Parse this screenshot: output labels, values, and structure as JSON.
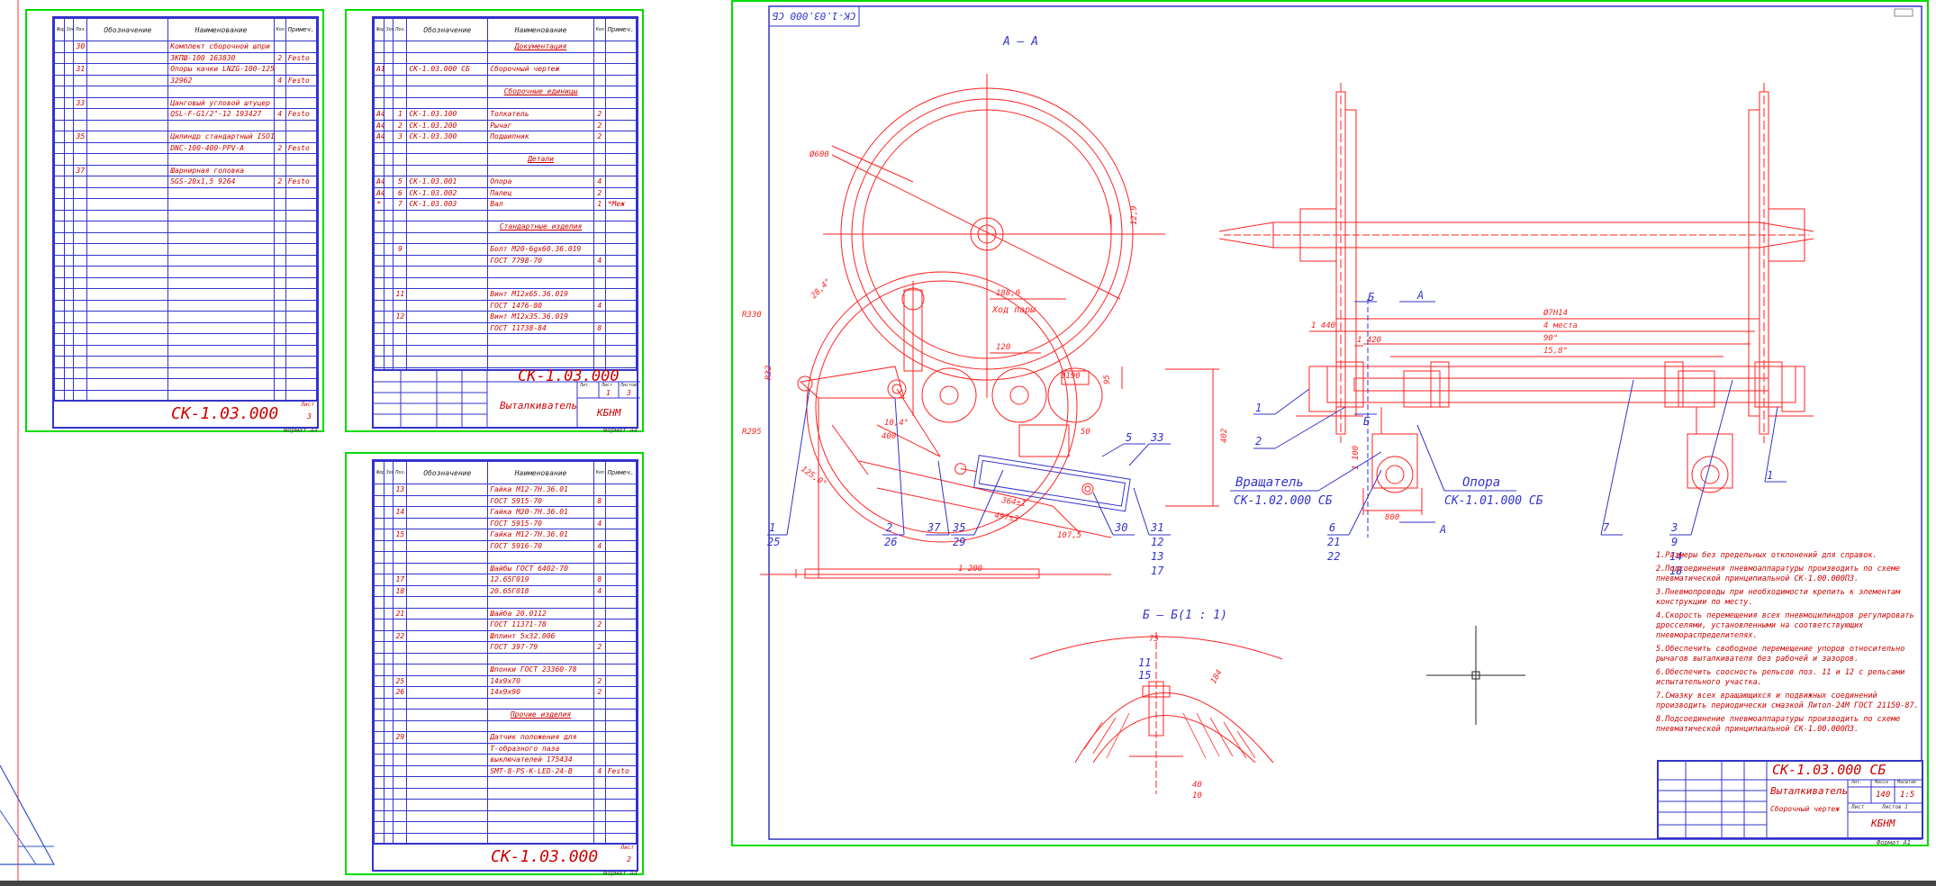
{
  "spec_headers": [
    "Формат",
    "Зона",
    "Поз.",
    "Обозначение",
    "Наименование",
    "Кол.",
    "Примеч."
  ],
  "sheet1": {
    "rows": [
      [
        "",
        "",
        "30",
        "",
        "Комплект сборочной шпри",
        "",
        ""
      ],
      [
        "",
        "",
        "",
        "",
        "ЗКПШ-100 163830",
        "2",
        "Festo"
      ],
      [
        "",
        "",
        "31",
        "",
        "Опоры качки LNZG-100-125",
        "",
        ""
      ],
      [
        "",
        "",
        "",
        "",
        "32962",
        "4",
        "Festo"
      ],
      [
        "",
        "",
        "",
        "",
        "",
        "",
        ""
      ],
      [
        "",
        "",
        "33",
        "",
        "Цанговый угловой штуцер",
        "",
        ""
      ],
      [
        "",
        "",
        "",
        "",
        "QSL-F-G1/2\"-12 193427",
        "4",
        "Festo"
      ],
      [
        "",
        "",
        "",
        "",
        "",
        "",
        ""
      ],
      [
        "",
        "",
        "35",
        "",
        "Цилиндр стандартный ISO15",
        "",
        ""
      ],
      [
        "",
        "",
        "",
        "",
        "DNC-100-400-PPV-A",
        "2",
        "Festo"
      ],
      [
        "",
        "",
        "",
        "",
        "",
        "",
        ""
      ],
      [
        "",
        "",
        "37",
        "",
        "Шарнирная головка",
        "",
        ""
      ],
      [
        "",
        "",
        "",
        "",
        "SGS-20x1,5 9264",
        "2",
        "Festo"
      ]
    ],
    "code": "СК-1.03.000",
    "sheet_label": "Лист",
    "sheet_num": "3",
    "format": "Формат А4"
  },
  "sheet2": {
    "rows": [
      [
        "",
        "",
        "",
        "",
        "Документация",
        "",
        ""
      ],
      [
        "",
        "",
        "",
        "",
        "",
        "",
        ""
      ],
      [
        "А1",
        "",
        "",
        "СК-1.03.000 СБ",
        "Сборочный чертеж",
        "",
        ""
      ],
      [
        "",
        "",
        "",
        "",
        "",
        "",
        ""
      ],
      [
        "",
        "",
        "",
        "",
        "Сборочные единицы",
        "",
        ""
      ],
      [
        "",
        "",
        "",
        "",
        "",
        "",
        ""
      ],
      [
        "А4",
        "",
        "1",
        "СК-1.03.100",
        "Толкатель",
        "2",
        ""
      ],
      [
        "А4",
        "",
        "2",
        "СК-1.03.200",
        "Рычаг",
        "2",
        ""
      ],
      [
        "А4",
        "",
        "3",
        "СК-1.03.300",
        "Подшипник",
        "2",
        ""
      ],
      [
        "",
        "",
        "",
        "",
        "",
        "",
        ""
      ],
      [
        "",
        "",
        "",
        "",
        "Детали",
        "",
        ""
      ],
      [
        "",
        "",
        "",
        "",
        "",
        "",
        ""
      ],
      [
        "А4",
        "",
        "5",
        "СК-1.03.001",
        "Опора",
        "4",
        ""
      ],
      [
        "А4",
        "",
        "6",
        "СК-1.03.002",
        "Палец",
        "2",
        ""
      ],
      [
        "*",
        "",
        "7",
        "СК-1.03.003",
        "Вал",
        "1",
        "*Меж"
      ],
      [
        "",
        "",
        "",
        "",
        "",
        "",
        ""
      ],
      [
        "",
        "",
        "",
        "",
        "Стандартные изделия",
        "",
        ""
      ],
      [
        "",
        "",
        "",
        "",
        "",
        "",
        ""
      ],
      [
        "",
        "",
        "9",
        "",
        "Болт М20-6gх60.36.019",
        "",
        ""
      ],
      [
        "",
        "",
        "",
        "",
        "ГОСТ 7798-70",
        "4",
        ""
      ],
      [
        "",
        "",
        "",
        "",
        "",
        "",
        ""
      ],
      [
        "",
        "",
        "",
        "",
        "",
        "",
        ""
      ],
      [
        "",
        "",
        "11",
        "",
        "Винт М12х65.36.019",
        "",
        ""
      ],
      [
        "",
        "",
        "",
        "",
        "ГОСТ 1476-80",
        "4",
        ""
      ],
      [
        "",
        "",
        "12",
        "",
        "Винт М12х35.36.019",
        "",
        ""
      ],
      [
        "",
        "",
        "",
        "",
        "ГОСТ 11738-84",
        "8",
        ""
      ]
    ],
    "code": "СК-1.03.000",
    "title": "Выталкиватель",
    "org": "КБНМ",
    "stamp_cols": [
      "Лит.",
      "Лист",
      "Листов"
    ],
    "sheet_num": "1",
    "sheet_total": "3",
    "format": "Формат А4"
  },
  "sheet3": {
    "rows": [
      [
        "",
        "",
        "13",
        "",
        "Гайка М12-7Н.36.01",
        "",
        ""
      ],
      [
        "",
        "",
        "",
        "",
        "ГОСТ 5915-70",
        "8",
        ""
      ],
      [
        "",
        "",
        "14",
        "",
        "Гайка М20-7Н.36.01",
        "",
        ""
      ],
      [
        "",
        "",
        "",
        "",
        "ГОСТ 5915-70",
        "4",
        ""
      ],
      [
        "",
        "",
        "15",
        "",
        "Гайка М12-7Н.36.01",
        "",
        ""
      ],
      [
        "",
        "",
        "",
        "",
        "ГОСТ 5916-70",
        "4",
        ""
      ],
      [
        "",
        "",
        "",
        "",
        "",
        "",
        ""
      ],
      [
        "",
        "",
        "",
        "",
        "Шайбы ГОСТ 6402-70",
        "",
        ""
      ],
      [
        "",
        "",
        "17",
        "",
        "12.65Г019",
        "8",
        ""
      ],
      [
        "",
        "",
        "18",
        "",
        "20.65Г018",
        "4",
        ""
      ],
      [
        "",
        "",
        "",
        "",
        "",
        "",
        ""
      ],
      [
        "",
        "",
        "21",
        "",
        "Шайба 20.0112",
        "",
        ""
      ],
      [
        "",
        "",
        "",
        "",
        "ГОСТ 11371-78",
        "2",
        ""
      ],
      [
        "",
        "",
        "22",
        "",
        "Шплинт 5х32.006",
        "",
        ""
      ],
      [
        "",
        "",
        "",
        "",
        "ГОСТ 397-79",
        "2",
        ""
      ],
      [
        "",
        "",
        "",
        "",
        "",
        "",
        ""
      ],
      [
        "",
        "",
        "",
        "",
        "Шпонки ГОСТ 23360-78",
        "",
        ""
      ],
      [
        "",
        "",
        "25",
        "",
        "14х9х70",
        "2",
        ""
      ],
      [
        "",
        "",
        "26",
        "",
        "14х9х90",
        "2",
        ""
      ],
      [
        "",
        "",
        "",
        "",
        "",
        "",
        ""
      ],
      [
        "",
        "",
        "",
        "",
        "Прочие изделия",
        "",
        ""
      ],
      [
        "",
        "",
        "",
        "",
        "",
        "",
        ""
      ],
      [
        "",
        "",
        "29",
        "",
        "Датчик положения для",
        "",
        ""
      ],
      [
        "",
        "",
        "",
        "",
        "T-образного паза",
        "",
        ""
      ],
      [
        "",
        "",
        "",
        "",
        "выключателей 175434",
        "",
        ""
      ],
      [
        "",
        "",
        "",
        "",
        "SMT-8-PS-K-LED-24-B",
        "4",
        "Festo"
      ]
    ],
    "code": "СК-1.03.000",
    "sheet_label": "Лист",
    "sheet_num": "2",
    "format": "Формат А4"
  },
  "drawing": {
    "code_mirrored": "СК-1.03.000 СБ",
    "section_aa": "А – А",
    "section_bb": "Б – Б(1 : 1)",
    "dims": [
      "Ø600",
      "R330",
      "R295",
      "400",
      "28,4°",
      "10,4°",
      "188,0",
      "Ход пары",
      "120",
      "12,9",
      "Ø190",
      "95",
      "402",
      "50",
      "364±1",
      "497±3",
      "107,5",
      "1 200",
      "125,0°",
      "R32",
      "Ø7Н14",
      "4 места",
      "90°",
      "15,8°",
      "1 440",
      "1 420",
      "1 100",
      "800",
      "40",
      "10",
      "75",
      "184"
    ],
    "callouts": [
      "1",
      "25",
      "2",
      "26",
      "37",
      "35",
      "29",
      "30",
      "31",
      "12",
      "13",
      "17",
      "5",
      "33",
      "11",
      "15",
      "6",
      "21",
      "22",
      "7",
      "3",
      "9",
      "14",
      "18"
    ],
    "labels": {
      "rotator": "Вращатель",
      "rotator_code": "СК-1.02.000 СБ",
      "support": "Опора",
      "support_code": "СК-1.01.000 СБ",
      "sec_b": "Б",
      "sec_a": "А"
    },
    "notes": [
      "1.Размеры без предельных отклонений для справок.",
      "2.Подсоединения пневмоаппаратуры производить по схеме пневматической принципиальной СК-1.00.000ПЗ.",
      "3.Пневмопроводы при необходимости крепить к элементам конструкции по месту.",
      "4.Скорость перемещения всех пневмоцилиндров регулировать дросселями, установленными на соответствующих пневмораспределителях.",
      "5.Обеспечить свободное перемещение упоров относительно рычагов выталкивателя без рабочей и зазоров.",
      "6.Обеспечить соосность рельсов поз. 11 и 12 с рельсами испытательного участка.",
      "7.Смазку всех вращающихся и подвижных соединений производить периодически смазкой Литол-24М ГОСТ 21150-87.",
      "8.Подсоединение пневмоаппаратуры производить по схеме пневматической принципиальной СК-1.00.000ПЗ."
    ],
    "title_block": {
      "code": "СК-1.03.000 СБ",
      "title": "Выталкиватель",
      "subtitle": "Сборочный чертеж",
      "mass": "140",
      "scale": "1:5",
      "cols": [
        "Лит.",
        "Масса",
        "Масштаб"
      ],
      "sheet": "Лист",
      "sheets": "Листов 1",
      "org": "КБНМ",
      "format": "Формат А1"
    }
  }
}
